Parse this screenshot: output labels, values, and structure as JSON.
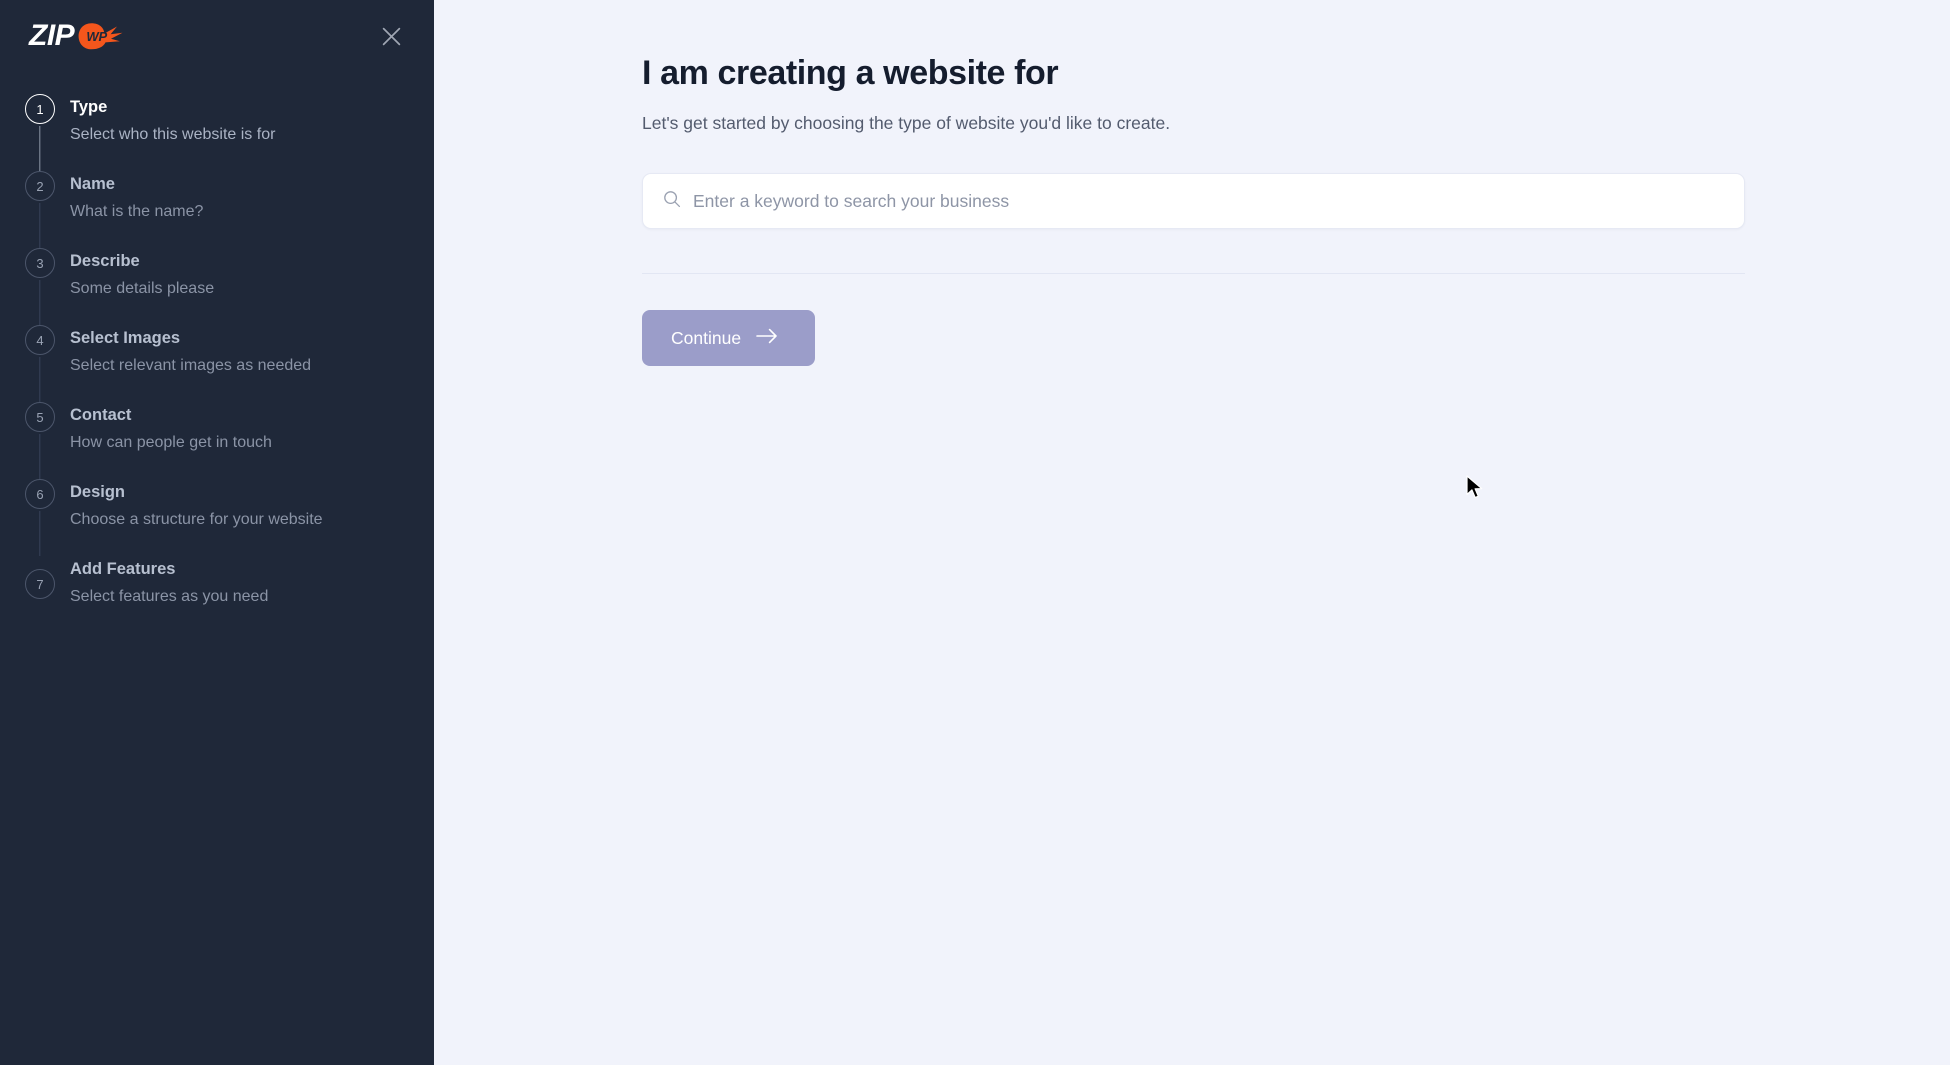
{
  "colors": {
    "sidebar_bg": "#1f2839",
    "main_bg": "#f1f3fb",
    "accent_orange": "#f4561c",
    "button_disabled": "#9b9dc9",
    "title_color": "#151d2e"
  },
  "sidebar": {
    "logo": {
      "word": "ZIP",
      "badge_text": "WP",
      "badge_icon": "flame-badge-icon"
    },
    "close_label": "Close",
    "steps": [
      {
        "number": "1",
        "title": "Type",
        "subtitle": "Select who this website is for",
        "active": true
      },
      {
        "number": "2",
        "title": "Name",
        "subtitle": "What is the name?",
        "active": false
      },
      {
        "number": "3",
        "title": "Describe",
        "subtitle": "Some details please",
        "active": false
      },
      {
        "number": "4",
        "title": "Select Images",
        "subtitle": "Select relevant images as needed",
        "active": false
      },
      {
        "number": "5",
        "title": "Contact",
        "subtitle": "How can people get in touch",
        "active": false
      },
      {
        "number": "6",
        "title": "Design",
        "subtitle": "Choose a structure for your website",
        "active": false
      },
      {
        "number": "7",
        "title": "Add Features",
        "subtitle": "Select features as you need",
        "active": false
      }
    ]
  },
  "main": {
    "title": "I am creating a website for",
    "subtitle": "Let's get started by choosing the type of website you'd like to create.",
    "search": {
      "placeholder": "Enter a keyword to search your business",
      "value": "",
      "icon": "search-icon"
    },
    "continue": {
      "label": "Continue",
      "icon": "arrow-right-icon",
      "disabled": true
    }
  }
}
